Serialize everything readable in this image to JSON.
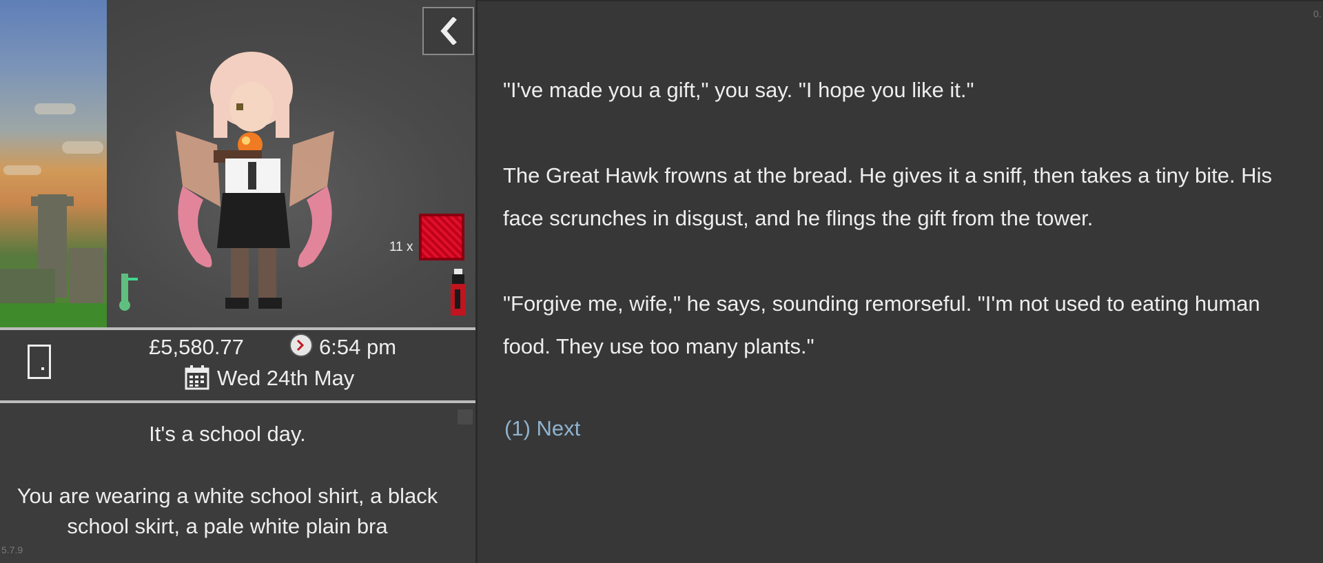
{
  "sidebar": {
    "item_count": "11 x",
    "money": "£5,580.77",
    "time": "6:54 pm",
    "date": "Wed 24th May",
    "day_note": "It's a school day.",
    "clothing_text": "You are wearing a white school shirt, a black school skirt, a pale white plain bra",
    "version": "5.7.9",
    "icons": {
      "back": "chevron-left-icon",
      "door": "door-icon",
      "clock": "clock-icon",
      "calendar": "calendar-icon"
    }
  },
  "story": {
    "paragraphs": [
      "\"I've made you a gift,\" you say. \"I hope you like it.\"",
      "The Great Hawk frowns at the bread. He gives it a sniff, then takes a tiny bite. His face scrunches in disgust, and he flings the gift from the tower.",
      "\"Forgive me, wife,\" he says, sounding remorseful. \"I'm not used to eating human food. They use too many plants.\""
    ],
    "next_link": "(1) Next"
  },
  "corner_text": "0.",
  "colors": {
    "background": "#373737",
    "sidebar": "#3c3c3c",
    "link": "#8fb3cf",
    "text": "#eeeeee"
  }
}
